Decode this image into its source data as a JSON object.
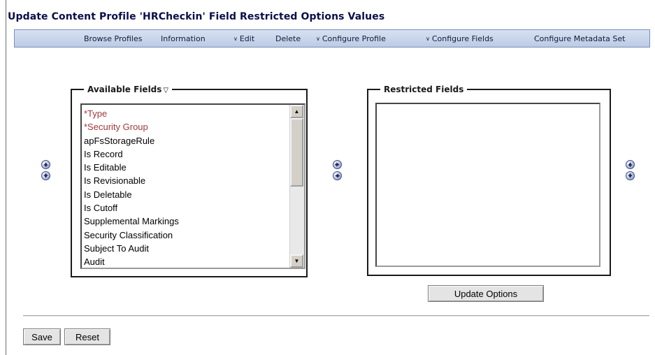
{
  "page": {
    "title": "Update Content Profile 'HRCheckin' Field Restricted Options Values"
  },
  "menu": {
    "items": [
      {
        "label": "Browse Profiles",
        "has_dropdown": false
      },
      {
        "label": "Information",
        "has_dropdown": false
      },
      {
        "label": "Edit",
        "has_dropdown": true
      },
      {
        "label": "Delete",
        "has_dropdown": false
      },
      {
        "label": "Configure Profile",
        "has_dropdown": true
      },
      {
        "label": "Configure Fields",
        "has_dropdown": true
      },
      {
        "label": "Configure Metadata Set",
        "has_dropdown": false
      }
    ],
    "dropdown_icon": "chevron-down-icon"
  },
  "available_fields": {
    "legend": "Available Fields",
    "legend_icon": "triangle-down-icon",
    "items": [
      {
        "label": "*Type",
        "required": true
      },
      {
        "label": "*Security Group",
        "required": true
      },
      {
        "label": "apFsStorageRule",
        "required": false
      },
      {
        "label": "Is Record",
        "required": false
      },
      {
        "label": "Is Editable",
        "required": false
      },
      {
        "label": "Is Revisionable",
        "required": false
      },
      {
        "label": "Is Deletable",
        "required": false
      },
      {
        "label": "Is Cutoff",
        "required": false
      },
      {
        "label": "Supplemental Markings",
        "required": false
      },
      {
        "label": "Security Classification",
        "required": false
      },
      {
        "label": "Subject To Audit",
        "required": false
      },
      {
        "label": "Audit",
        "required": false
      }
    ],
    "scroll_position": 0
  },
  "restricted_fields": {
    "legend": "Restricted Fields",
    "items": []
  },
  "controls": {
    "left_reorder": [
      "move-up-icon",
      "move-down-icon"
    ],
    "transfer": [
      "move-right-icon",
      "move-left-icon"
    ],
    "right_reorder": [
      "move-up-icon",
      "move-down-icon"
    ]
  },
  "buttons": {
    "update_options": "Update Options",
    "save": "Save",
    "reset": "Reset"
  },
  "colors": {
    "required_field": "#a03a3a",
    "menubar": "#c8d5ea",
    "title": "#0b0f4a"
  }
}
